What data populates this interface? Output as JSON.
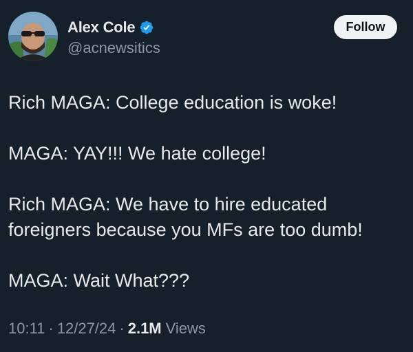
{
  "user": {
    "display_name": "Alex Cole",
    "handle": "@acnewsitics",
    "verified": true,
    "avatar": "profile-photo"
  },
  "follow_button": {
    "label": "Follow"
  },
  "tweet": {
    "lines": [
      "Rich MAGA: College education is woke!",
      "MAGA: YAY!!! We hate college!",
      "Rich MAGA: We have to hire educated",
      "foreigners because you MFs are too dumb!",
      "MAGA: Wait What???"
    ]
  },
  "meta": {
    "time": "10:11",
    "separator": "·",
    "date": "12/27/24",
    "views_count": "2.1M",
    "views_label": "Views"
  },
  "colors": {
    "background": "#16202b",
    "primary_text": "#e7e9ea",
    "secondary_text": "#8b98a5",
    "verified_badge": "#1d9bf0",
    "follow_button_bg": "#eff3f4"
  }
}
